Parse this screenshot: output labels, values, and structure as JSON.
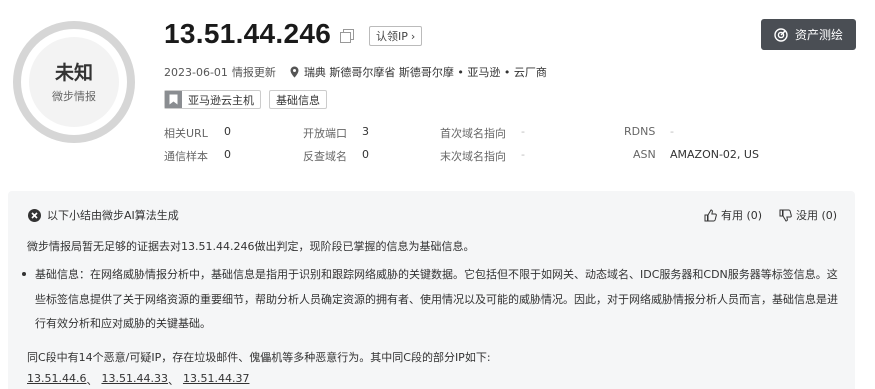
{
  "verdict": {
    "label": "未知",
    "source": "微步情报"
  },
  "ip": {
    "address": "13.51.44.246",
    "claim_label": "认领IP",
    "claim_arrow": "›"
  },
  "actions": {
    "measure_label": "资产测绘"
  },
  "meta": {
    "date": "2023-06-01",
    "date_suffix": "情报更新",
    "location": "瑞典 斯德哥尔摩省 斯德哥尔摩 • 亚马逊 • 云厂商"
  },
  "tags": [
    {
      "label": "亚马逊云主机"
    },
    {
      "label": "基础信息"
    }
  ],
  "stats": {
    "related_url": {
      "label": "相关URL",
      "value": "0"
    },
    "open_ports": {
      "label": "开放端口",
      "value": "3"
    },
    "first_domain": {
      "label": "首次域名指向",
      "value": "-"
    },
    "rdns": {
      "label": "RDNS",
      "value": "-"
    },
    "comm_samples": {
      "label": "通信样本",
      "value": "0"
    },
    "reverse_domain": {
      "label": "反查域名",
      "value": "0"
    },
    "last_domain": {
      "label": "末次域名指向",
      "value": "-"
    },
    "asn": {
      "label": "ASN",
      "value": "AMAZON-02, US"
    }
  },
  "ai": {
    "heading": "以下小结由微步AI算法生成",
    "useful_label": "有用 (0)",
    "useless_label": "没用 (0)",
    "summary": "微步情报局暂无足够的证据去对13.51.44.246做出判定，现阶段已掌握的信息为基础信息。",
    "bullet": "基础信息：在网络威胁情报分析中，基础信息是指用于识别和跟踪网络威胁的关键数据。它包括但不限于如网关、动态域名、IDC服务器和CDN服务器等标签信息。这些标签信息提供了关于网络资源的重要细节，帮助分析人员确定资源的拥有者、使用情况以及可能的威胁情况。因此，对于网络威胁情报分析人员而言，基础信息是进行有效分析和应对威胁的关键基础。",
    "c_segment": "同C段中有14个恶意/可疑IP，存在垃圾邮件、傀儡机等多种恶意行为。其中同C段的部分IP如下:",
    "c_ips": [
      "13.51.44.6",
      "13.51.44.33",
      "13.51.44.37"
    ],
    "separator": "、"
  },
  "colors": {
    "button_dark": "#4a4e54",
    "panel_bg": "#f5f6f7",
    "ring": "#d6d6d6"
  }
}
